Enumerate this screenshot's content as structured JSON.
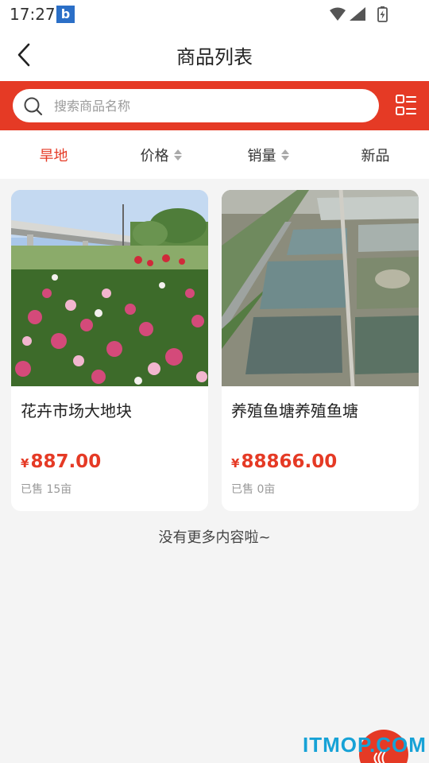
{
  "status_bar": {
    "time": "17:27",
    "app_icon_letter": "b"
  },
  "nav": {
    "title": "商品列表"
  },
  "search": {
    "placeholder": "搜索商品名称",
    "value": ""
  },
  "filters": [
    {
      "label": "旱地",
      "active": true
    },
    {
      "label": "价格",
      "sortable": true
    },
    {
      "label": "销量",
      "sortable": true
    },
    {
      "label": "新品"
    }
  ],
  "products": [
    {
      "name": "花卉市场大地块",
      "currency": "¥",
      "price": "887.00",
      "sold": "已售 15亩"
    },
    {
      "name": "养殖鱼塘养殖鱼塘",
      "currency": "¥",
      "price": "88866.00",
      "sold": "已售 0亩"
    }
  ],
  "footer": {
    "no_more": "没有更多内容啦~"
  },
  "watermark": "ITMOP.COM",
  "colors": {
    "accent": "#e53a25",
    "background": "#f4f4f4",
    "watermark": "#17a2d6"
  }
}
